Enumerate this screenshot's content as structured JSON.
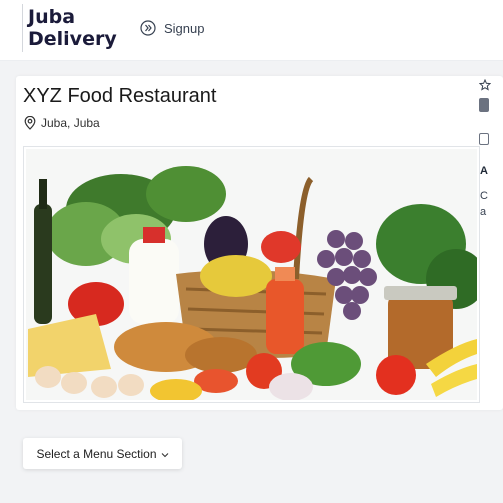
{
  "header": {
    "brand_line1": "Juba",
    "brand_line2": "Delivery",
    "signup_label": "Signup"
  },
  "restaurant": {
    "name": "XYZ Food Restaurant",
    "location": "Juba, Juba"
  },
  "sidebar_partial": {
    "label_a": "A",
    "text_c": "C",
    "text_a": "a"
  },
  "menu": {
    "select_label": "Select a Menu Section"
  },
  "colors": {
    "brand": "#1b1b3a",
    "page_bg": "#f2f3f5"
  },
  "icons": {
    "signup": "circle-double-chevron-right-icon",
    "location": "map-pin-icon",
    "favorite": "star-outline-icon",
    "menu_caret": "chevron-down-icon"
  }
}
